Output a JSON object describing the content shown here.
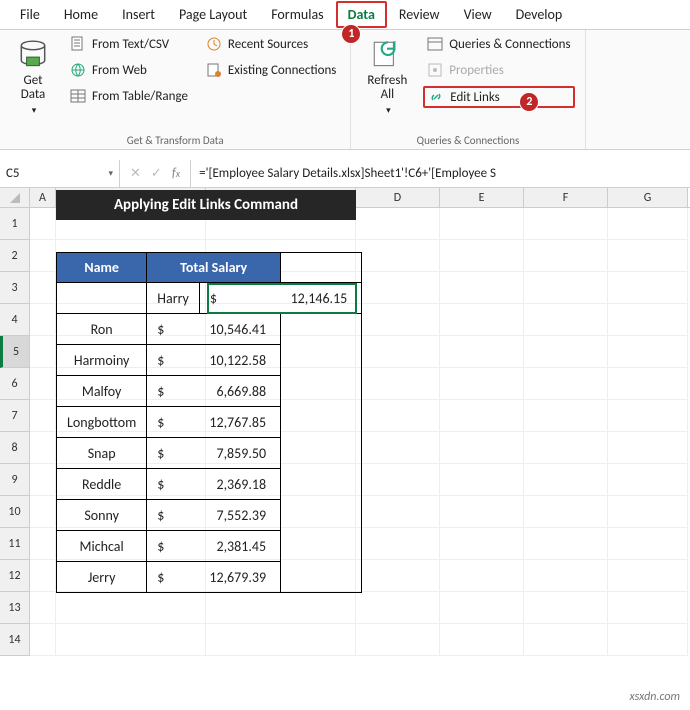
{
  "tabs": [
    "File",
    "Home",
    "Insert",
    "Page Layout",
    "Formulas",
    "Data",
    "Review",
    "View",
    "Develop"
  ],
  "active_tab": "Data",
  "ribbon": {
    "group1_label": "Get & Transform Data",
    "get_data": "Get\nData",
    "from_text": "From Text/CSV",
    "from_web": "From Web",
    "from_table": "From Table/Range",
    "recent": "Recent Sources",
    "existing": "Existing Connections",
    "group2_label": "Queries & Connections",
    "refresh": "Refresh\nAll",
    "queries": "Queries & Connections",
    "properties": "Properties",
    "edit_links": "Edit Links"
  },
  "badges": {
    "b1": "1",
    "b2": "2"
  },
  "namebox": "C5",
  "formula": "='[Employee Salary Details.xlsx]Sheet1'!C6+'[Employee S",
  "cols": [
    "A",
    "B",
    "C",
    "D",
    "E",
    "F",
    "G"
  ],
  "rownums": [
    "1",
    "2",
    "3",
    "4",
    "5",
    "6",
    "7",
    "8",
    "9",
    "10",
    "11",
    "12",
    "13",
    "14"
  ],
  "title": "Applying Edit Links Command",
  "headers": {
    "name": "Name",
    "salary": "Total Salary"
  },
  "cur": "$",
  "data_rows": [
    {
      "name": "Harry",
      "val": "12,146.15"
    },
    {
      "name": "Ron",
      "val": "10,546.41"
    },
    {
      "name": "Harmoiny",
      "val": "10,122.58"
    },
    {
      "name": "Malfoy",
      "val": "6,669.88"
    },
    {
      "name": "Longbottom",
      "val": "12,767.85"
    },
    {
      "name": "Snap",
      "val": "7,859.50"
    },
    {
      "name": "Reddle",
      "val": "2,369.18"
    },
    {
      "name": "Sonny",
      "val": "7,552.39"
    },
    {
      "name": "Michcal",
      "val": "2,381.45"
    },
    {
      "name": "Jerry",
      "val": "12,679.39"
    }
  ],
  "watermark": "xsxdn.com"
}
